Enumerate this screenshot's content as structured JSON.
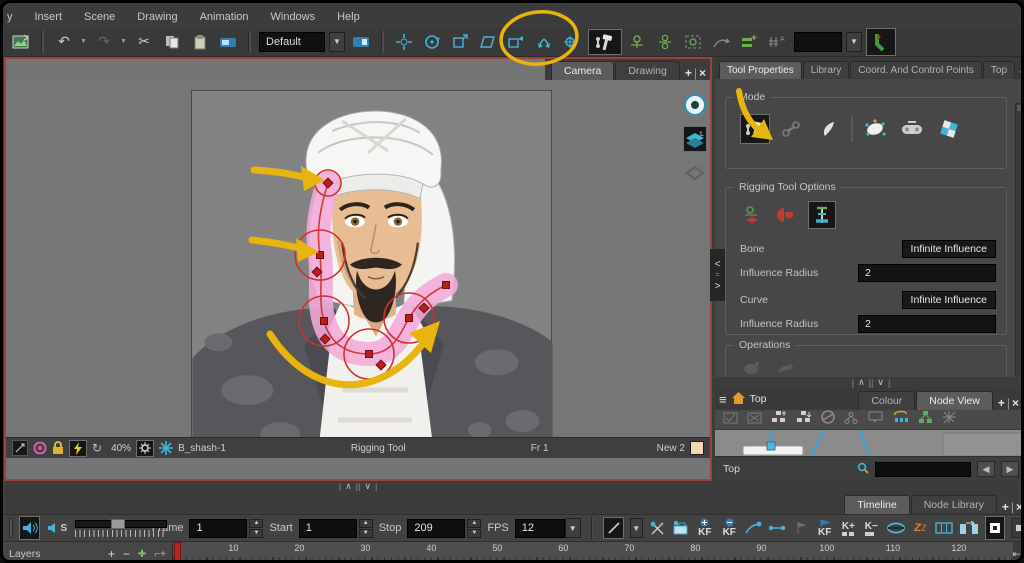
{
  "colors": {
    "accent_cyan": "#46b4d4",
    "annotation_yellow": "#e7b50d",
    "deformer_pink": "#f3aad8",
    "control_red": "#c32222",
    "active_view_border": "#9a423d",
    "colour_swatch": "#efd9b4"
  },
  "menu": {
    "items": [
      "y",
      "Insert",
      "Scene",
      "Drawing",
      "Animation",
      "Windows",
      "Help"
    ]
  },
  "toolbar": {
    "preset_dropdown_value": "Default"
  },
  "camera_view": {
    "tabs": [
      {
        "label": "Camera"
      },
      {
        "label": "Drawing"
      }
    ],
    "add_tab": "+",
    "close_tab": "×",
    "overlay_letters": {
      "layers": "L",
      "camera_mask": "C"
    },
    "status": {
      "zoom_level": "40%",
      "layer_name": "B_shash-1",
      "tool_name": "Rigging Tool",
      "frame_indicator": "Fr 1",
      "colour_name": "New 2"
    }
  },
  "tool_properties": {
    "tabs": [
      "Tool Properties",
      "Library",
      "Coord. And Control Points",
      "Top"
    ],
    "add_tab": "+",
    "close_tab": "×",
    "mode_section_title": "Mode",
    "rigging_section": {
      "title": "Rigging Tool Options",
      "bone_label": "Bone",
      "bone_value": "Infinite Influence",
      "bone_radius_label": "Influence Radius",
      "bone_radius_value": "2",
      "curve_label": "Curve",
      "curve_value": "Infinite Influence",
      "curve_radius_label": "Influence Radius",
      "curve_radius_value": "2"
    },
    "operations_section_title": "Operations"
  },
  "node_view": {
    "breadcrumb": "Top",
    "tabs": [
      "Colour",
      "Node View"
    ],
    "add_tab": "+",
    "close_tab": "×",
    "bottom_breadcrumb": "Top"
  },
  "timeline": {
    "tabs": [
      "Timeline",
      "Node Library"
    ],
    "add_tab": "+",
    "close_tab": "×",
    "sound_scrub_label": "S",
    "frame_label": "Frame",
    "frame_value": "1",
    "start_label": "Start",
    "start_value": "1",
    "stop_label": "Stop",
    "stop_value": "209",
    "fps_label": "FPS",
    "fps_value": "12",
    "keyframe_add_label": "KF",
    "keyframe_del_label": "KF",
    "k_plus_label": "K+",
    "k_minus_label": "K−",
    "layers_label": "Layers",
    "ruler_ticks": [
      10,
      20,
      30,
      40,
      50,
      60,
      70,
      80,
      90,
      100,
      110,
      120
    ],
    "playhead_frame": 1
  }
}
